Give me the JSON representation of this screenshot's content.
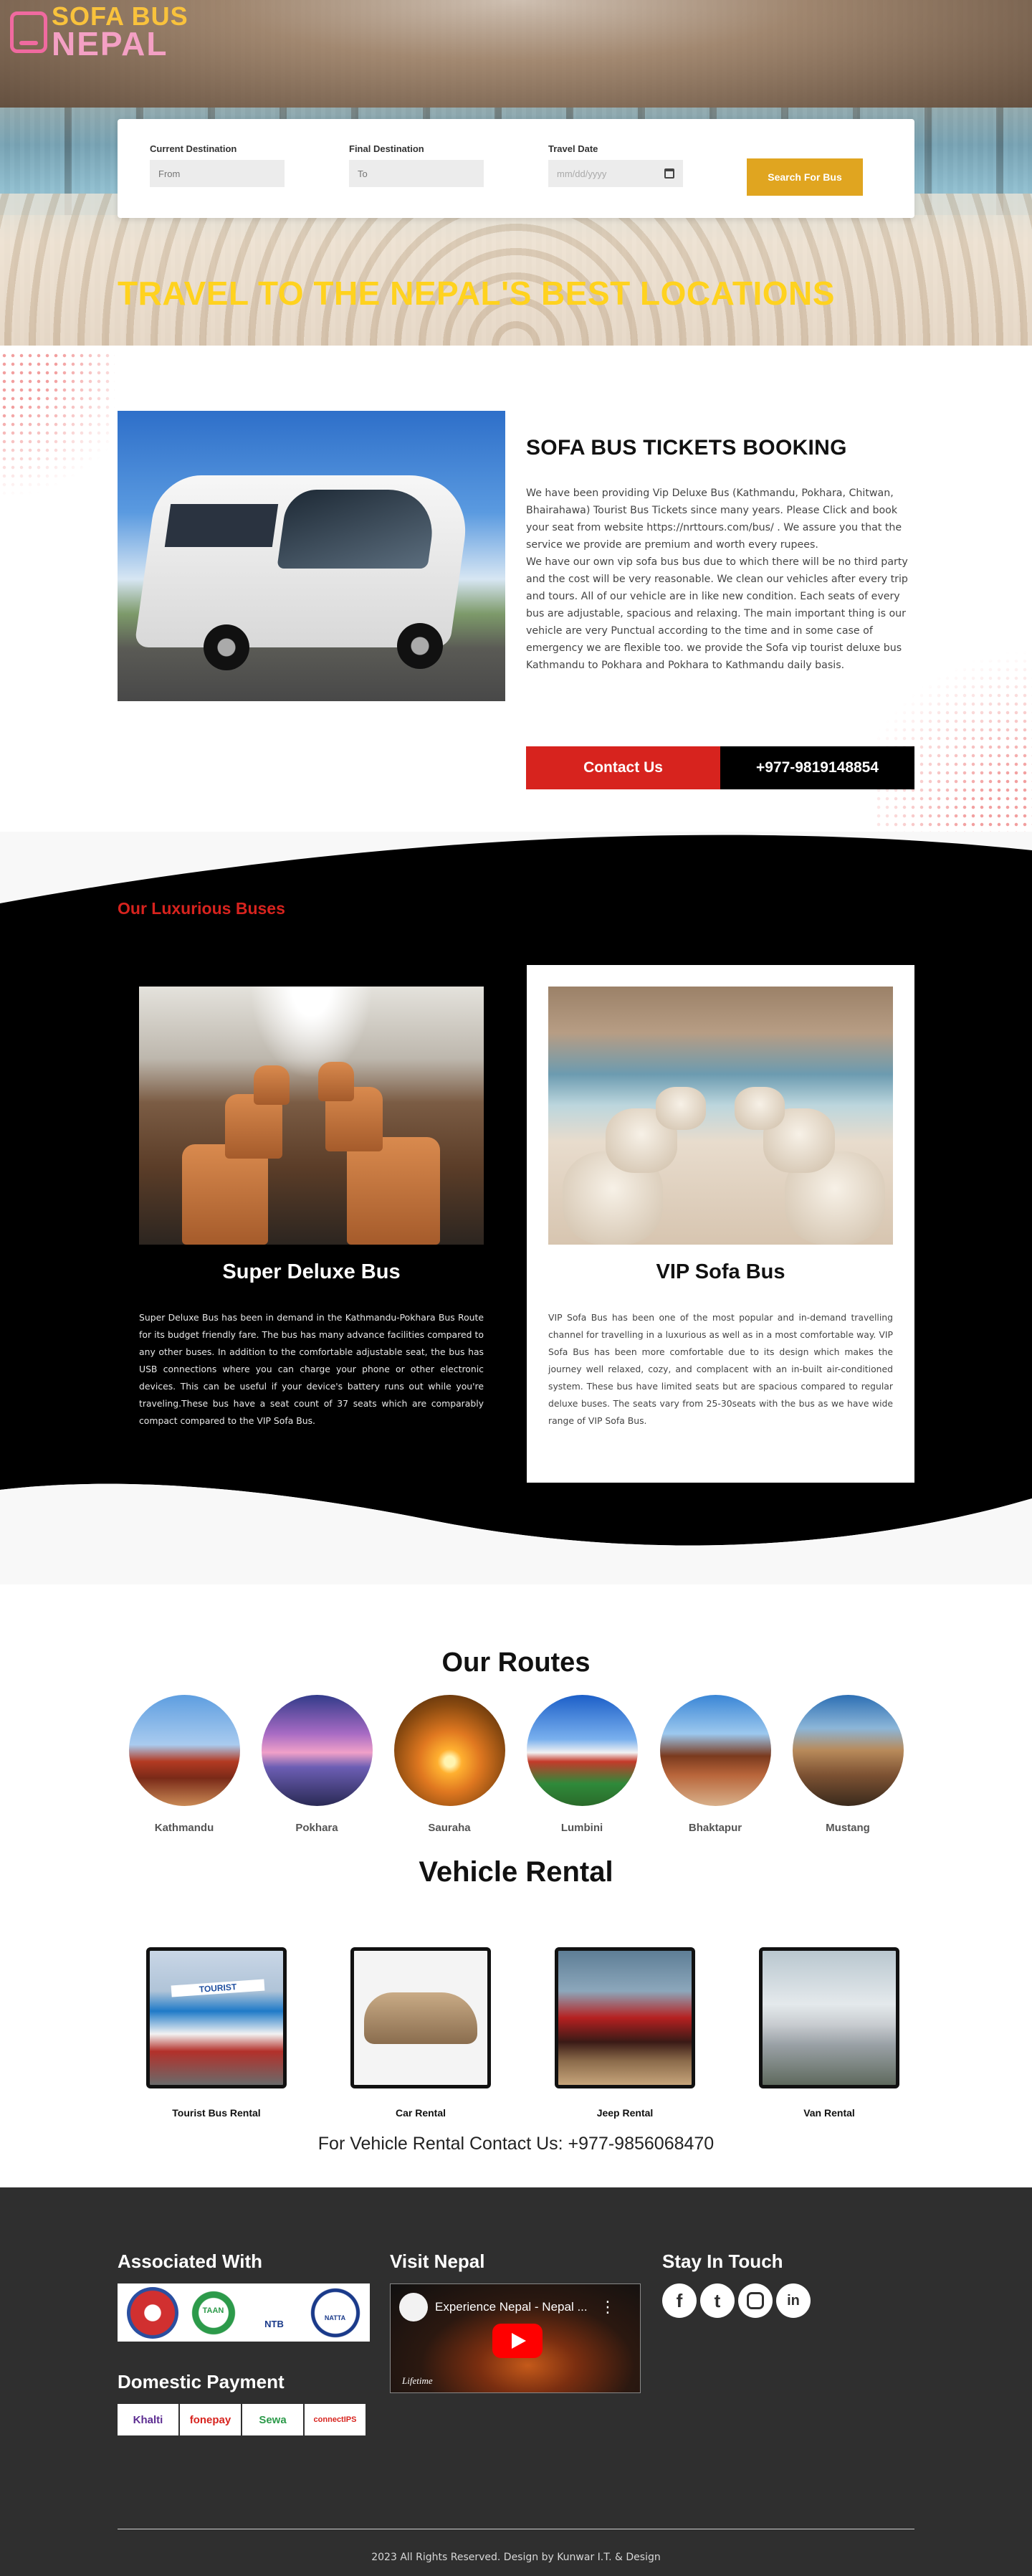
{
  "brand": {
    "line1": "SOFA BUS",
    "line2": "NEPAL"
  },
  "search": {
    "current_label": "Current Destination",
    "current_placeholder": "From",
    "final_label": "Final Destination",
    "final_placeholder": "To",
    "date_label": "Travel Date",
    "date_placeholder": "mm/dd/yyyy",
    "button": "Search For Bus"
  },
  "hero": {
    "title": "TRAVEL TO THE NEPAL'S BEST LOCATIONS"
  },
  "about": {
    "title": "SOFA BUS TICKETS BOOKING",
    "paragraph1": "We have been providing Vip Deluxe Bus (Kathmandu, Pokhara, Chitwan, Bhairahawa) Tourist Bus Tickets since many years. Please Click and book your seat from website https://nrttours.com/bus/ . We assure you that the service we provide are premium and worth every rupees.",
    "paragraph2": "We have our own vip sofa bus bus due to which there will be no third party and the cost will be very reasonable. We clean our vehicles after every trip and tours. All of our vehicle are in like new condition. Each seats of every bus are adjustable, spacious and relaxing. The main important thing is our vehicle are very Punctual according to the time and in some case of emergency we are flexible too. we provide the Sofa vip tourist deluxe bus Kathmandu to Pokhara and Pokhara to Kathmandu daily basis.",
    "contact_button": "Contact Us",
    "phone_button": "+977-9819148854"
  },
  "buses": {
    "heading": "Our Luxurious Buses",
    "items": [
      {
        "name": "Super Deluxe Bus",
        "description": "Super Deluxe Bus has been in demand in the Kathmandu-Pokhara Bus Route for its budget friendly fare. The bus has many advance facilities compared to any other buses. In addition to the comfortable adjustable seat, the bus has USB connections where you can charge your phone or other electronic devices. This can be useful if your device's battery runs out while you're traveling.These bus have a seat count of 37 seats which are comparably compact compared to the VIP Sofa Bus."
      },
      {
        "name": "VIP Sofa Bus",
        "description": "VIP Sofa Bus has been one of the most popular and in-demand travelling channel for travelling in a luxurious as well as in a most comfortable way. VIP Sofa Bus has been more comfortable due to its design which makes the journey well relaxed, cozy, and complacent with an in-built air-conditioned system. These bus have limited seats but are spacious compared to regular deluxe buses. The seats vary from 25-30seats with the bus as we have wide range of VIP Sofa Bus."
      }
    ]
  },
  "routes": {
    "title": "Our Routes",
    "items": [
      "Kathmandu",
      "Pokhara",
      "Sauraha",
      "Lumbini",
      "Bhaktapur",
      "Mustang"
    ]
  },
  "rental": {
    "title": "Vehicle Rental",
    "items": [
      "Tourist Bus Rental",
      "Car Rental",
      "Jeep Rental",
      "Van Rental"
    ],
    "contact": "For Vehicle Rental Contact Us: +977-9856068470",
    "bus_sign": "TOURIST"
  },
  "footer": {
    "associated": "Associated With",
    "org_labels": [
      "",
      "TAAN",
      "NTB",
      "NATTA"
    ],
    "payment_heading": "Domestic Payment",
    "payments": [
      "Khalti",
      "fonepay",
      "Sewa",
      "connectIPS"
    ],
    "visit": "Visit Nepal",
    "video_title": "Experience Nepal - Nepal ...",
    "video_watermark": "Lifetime",
    "stay": "Stay In Touch",
    "social": [
      "facebook-icon",
      "twitter-icon",
      "instagram-icon",
      "linkedin-icon"
    ],
    "copyright": "2023 All Rights Reserved. Design by Kunwar I.T. & Design"
  },
  "colors": {
    "accent_red": "#d7231e",
    "gold": "#e0a520",
    "hero_title": "#ffd21f",
    "footer_bg": "#2f2f2f"
  }
}
